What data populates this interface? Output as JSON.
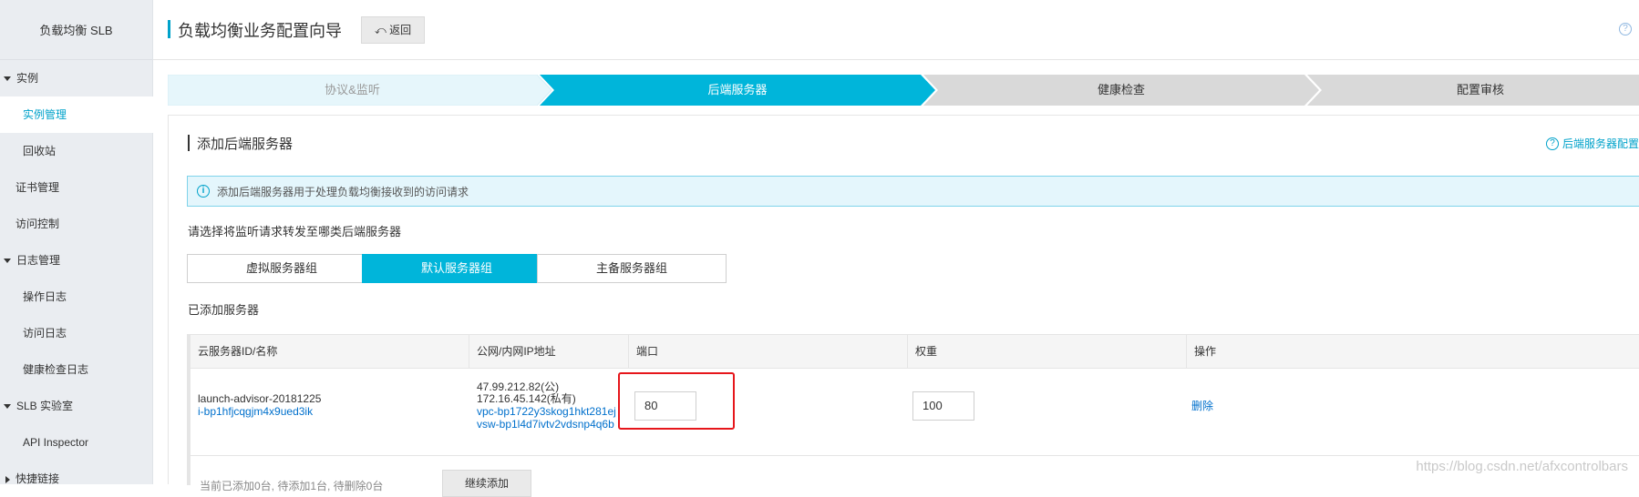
{
  "sidebar": {
    "title": "负载均衡 SLB",
    "items": [
      {
        "label": "实例",
        "type": "group",
        "expanded": true
      },
      {
        "label": "实例管理",
        "type": "child",
        "active": true
      },
      {
        "label": "回收站",
        "type": "child"
      },
      {
        "label": "证书管理",
        "type": "top"
      },
      {
        "label": "访问控制",
        "type": "top"
      },
      {
        "label": "日志管理",
        "type": "group",
        "expanded": true
      },
      {
        "label": "操作日志",
        "type": "child"
      },
      {
        "label": "访问日志",
        "type": "child"
      },
      {
        "label": "健康检查日志",
        "type": "child"
      },
      {
        "label": "SLB 实验室",
        "type": "group",
        "expanded": true
      },
      {
        "label": "API Inspector",
        "type": "child"
      },
      {
        "label": "快捷链接",
        "type": "group",
        "expanded": false
      }
    ]
  },
  "header": {
    "title": "负载均衡业务配置向导",
    "back_label": "返回",
    "back_icon": "undo-arrow-icon",
    "help_icon": "?"
  },
  "steps": [
    {
      "label": "协议&监听",
      "state": "done"
    },
    {
      "label": "后端服务器",
      "state": "active"
    },
    {
      "label": "健康检查",
      "state": "todo"
    },
    {
      "label": "配置审核",
      "state": "todo"
    }
  ],
  "colors": {
    "accent": "#00b5da",
    "done_step": "#e6f6fb",
    "todo_step": "#d9d9d9",
    "highlight": "#e6161b"
  },
  "panel": {
    "section_title": "添加后端服务器",
    "help_link": "后端服务器配置",
    "help_icon": "?",
    "info_icon": "i",
    "info_text": "添加后端服务器用于处理负载均衡接收到的访问请求",
    "choose_label": "请选择将监听请求转发至哪类后端服务器",
    "server_groups": [
      {
        "label": "虚拟服务器组",
        "active": false
      },
      {
        "label": "默认服务器组",
        "active": true
      },
      {
        "label": "主备服务器组",
        "active": false
      }
    ],
    "added_label": "已添加服务器"
  },
  "table": {
    "columns": [
      "云服务器ID/名称",
      "公网/内网IP地址",
      "端口",
      "权重",
      "操作"
    ],
    "rows": [
      {
        "name": "launch-advisor-20181225",
        "id": "i-bp1hfjcqgjm4x9ued3ik",
        "public_ip": "47.99.212.82(公)",
        "private_ip": "172.16.45.142(私有)",
        "vpc": "vpc-bp1722y3skog1hkt281ej",
        "vsw": "vsw-bp1l4d7ivtv2vdsnp4q6b",
        "port": "80",
        "weight": "100",
        "action": "删除"
      }
    ],
    "footer_text": "当前已添加0台, 待添加1台, 待删除0台",
    "continue_label": "继续添加"
  },
  "watermark": "https://blog.csdn.net/afxcontrolbars"
}
